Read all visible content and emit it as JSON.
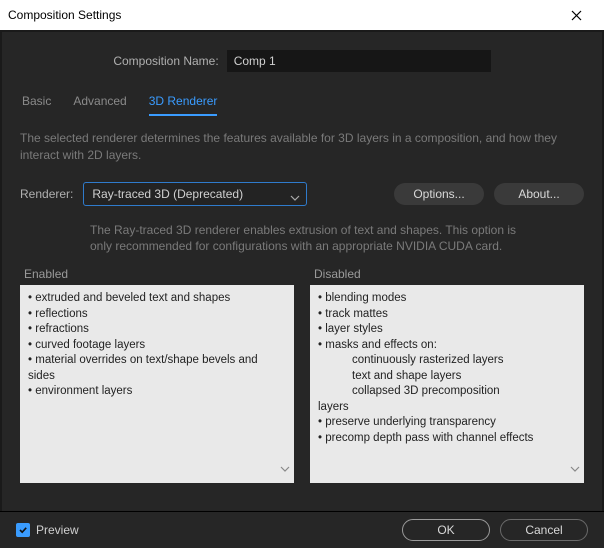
{
  "window": {
    "title": "Composition Settings"
  },
  "comp_name": {
    "label": "Composition Name:",
    "value": "Comp 1"
  },
  "tabs": [
    {
      "label": "Basic"
    },
    {
      "label": "Advanced"
    },
    {
      "label": "3D Renderer"
    }
  ],
  "active_tab": 2,
  "description": "The selected renderer determines the features available for 3D layers in a composition, and how they interact with 2D layers.",
  "renderer": {
    "label": "Renderer:",
    "selected": "Ray-traced 3D (Deprecated)",
    "options_btn": "Options...",
    "about_btn": "About...",
    "note": "The Ray-traced 3D renderer enables extrusion of text and shapes. This option is only recommended for configurations with an appropriate NVIDIA CUDA card."
  },
  "panels": {
    "enabled": {
      "title": "Enabled",
      "items": [
        "extruded and beveled text and shapes",
        "reflections",
        "refractions",
        "curved footage layers",
        "material overrides on text/shape bevels and sides",
        "environment layers"
      ]
    },
    "disabled": {
      "title": "Disabled",
      "items_flat": [
        "blending modes",
        "track mattes",
        "layer styles",
        "masks and effects on:"
      ],
      "items_sub": [
        "continuously rasterized layers",
        "text and shape layers",
        "collapsed 3D precomposition"
      ],
      "cont_word": "layers",
      "items_tail": [
        "preserve underlying transparency",
        "precomp depth pass with channel effects"
      ]
    }
  },
  "footer": {
    "preview_label": "Preview",
    "preview_checked": true,
    "ok": "OK",
    "cancel": "Cancel"
  }
}
